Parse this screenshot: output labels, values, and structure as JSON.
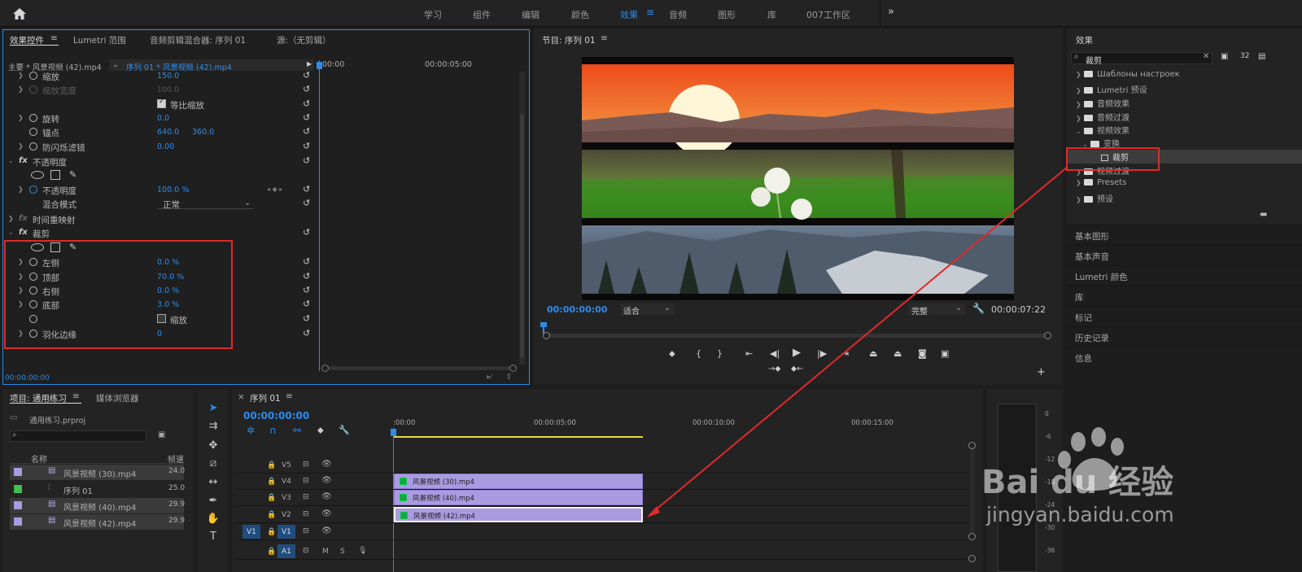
{
  "workspaces": [
    "学习",
    "组件",
    "编辑",
    "颜色",
    "效果",
    "音频",
    "图形",
    "库",
    "007工作区"
  ],
  "active_workspace": "效果",
  "effect_controls": {
    "tabs": [
      "效果控件",
      "Lumetri 范围",
      "音频剪辑混合器: 序列 01",
      "源:（无剪辑）"
    ],
    "clip_path": "主要 * 风景视频 (42).mp4",
    "clip_seq": "序列 01 * 风景视频 (42).mp4",
    "ruler": [
      "00:00",
      "00:00:05:00"
    ],
    "props": {
      "scale": "缩放",
      "scale_v": "150.0",
      "scale_w": "缩放宽度",
      "scale_w_v": "100.0",
      "uniform": "等比缩放",
      "rotate": "旋转",
      "rotate_v": "0.0",
      "anchor": "锚点",
      "anchor_x": "640.0",
      "anchor_y": "360.0",
      "flicker": "防闪烁滤镜",
      "flicker_v": "0.00",
      "opacity_fx": "不透明度",
      "opacity": "不透明度",
      "opacity_v": "100.0 %",
      "blend": "混合模式",
      "blend_v": "正常",
      "remap": "时间重映射",
      "crop_fx": "裁剪",
      "left": "左侧",
      "left_v": "0.0 %",
      "top": "顶部",
      "top_v": "70.0 %",
      "right": "右侧",
      "right_v": "0.0 %",
      "bottom": "底部",
      "bottom_v": "3.0 %",
      "zoom": "缩放",
      "feather": "羽化边缘",
      "feather_v": "0"
    },
    "timecode": "00:00:00:00"
  },
  "program": {
    "title": "节目: 序列 01",
    "timecode": "00:00:00:00",
    "fit": "适合",
    "quality": "完整",
    "duration": "00:00:07:22"
  },
  "effects_panel": {
    "title": "效果",
    "search": "裁剪",
    "tree": [
      "Шаблоны настроек",
      "Lumetri 预设",
      "音频效果",
      "音频过渡",
      "视频效果",
      "变换",
      "裁剪",
      "视频过渡",
      "Presets",
      "预设"
    ],
    "sections": [
      "基本图形",
      "基本声音",
      "Lumetri 颜色",
      "库",
      "标记",
      "历史记录",
      "信息"
    ]
  },
  "project": {
    "tabs": [
      "项目: 通用练习",
      "媒体浏览器"
    ],
    "file": "通用练习.prproj",
    "col_name": "名称",
    "col_fps": "帧速",
    "items": [
      {
        "name": "风景视频 (30).mp4",
        "fps": "24.0",
        "color": "#a99be0"
      },
      {
        "name": "序列 01",
        "fps": "25.0",
        "color": "#3fbf4f"
      },
      {
        "name": "风景视频 (40).mp4",
        "fps": "29.9",
        "color": "#a99be0"
      },
      {
        "name": "风景视频 (42).mp4",
        "fps": "29.9",
        "color": "#a99be0"
      }
    ]
  },
  "timeline": {
    "tab": "序列 01",
    "timecode": "00:00:00:00",
    "ruler": [
      ":00:00",
      "00:00:05:00",
      "00:00:10:00",
      "00:00:15:00"
    ],
    "tracks": [
      "V5",
      "V4",
      "V3",
      "V2",
      "V1",
      "A1"
    ],
    "src_v": "V1",
    "src_a": "A1",
    "mute": "M",
    "solo": "S",
    "clips": [
      "风景视频 (30).mp4",
      "风景视频 (40).mp4",
      "风景视频 (42).mp4"
    ]
  },
  "meter": {
    "ticks": [
      "0",
      "-6",
      "-12",
      "-18",
      "-24",
      "-30",
      "-36"
    ]
  },
  "watermark": {
    "brand": "Bai du 经验",
    "url": "jingyan.baidu.com"
  }
}
